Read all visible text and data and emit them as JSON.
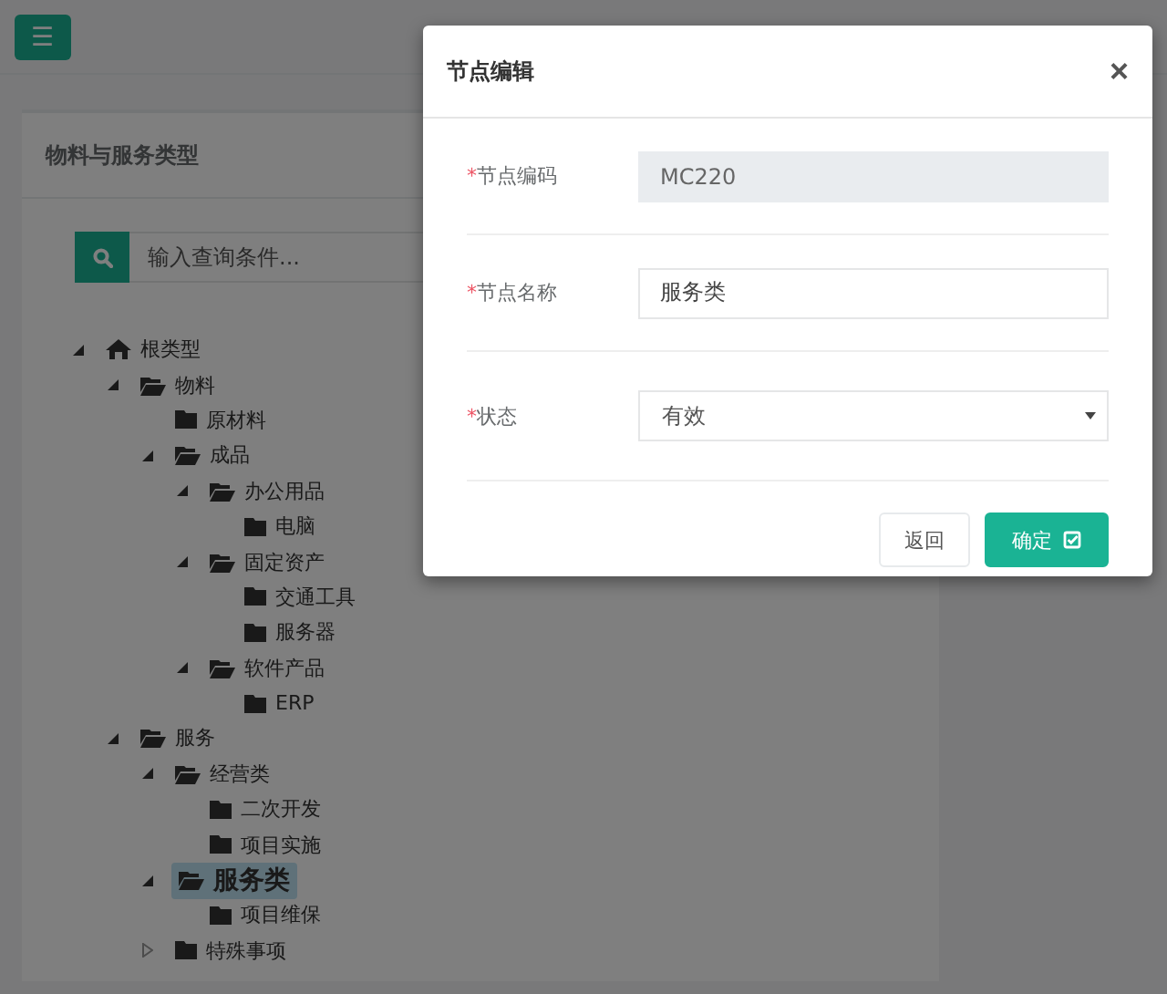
{
  "header": {
    "menu_button": "☰"
  },
  "panel": {
    "title": "物料与服务类型",
    "search": {
      "placeholder": "输入查询条件..."
    },
    "tree": [
      {
        "label": "根类型",
        "kind": "home",
        "expanded": true,
        "selected": false,
        "children": [
          {
            "label": "物料",
            "kind": "folder",
            "expanded": true,
            "selected": false,
            "children": [
              {
                "label": "原材料",
                "kind": "folder",
                "selected": false
              },
              {
                "label": "成品",
                "kind": "folder",
                "expanded": true,
                "selected": false,
                "children": [
                  {
                    "label": "办公用品",
                    "kind": "folder",
                    "expanded": true,
                    "selected": false,
                    "children": [
                      {
                        "label": "电脑",
                        "kind": "folder",
                        "selected": false
                      }
                    ]
                  },
                  {
                    "label": "固定资产",
                    "kind": "folder",
                    "expanded": true,
                    "selected": false,
                    "children": [
                      {
                        "label": "交通工具",
                        "kind": "folder",
                        "selected": false
                      },
                      {
                        "label": "服务器",
                        "kind": "folder",
                        "selected": false
                      }
                    ]
                  },
                  {
                    "label": "软件产品",
                    "kind": "folder",
                    "expanded": true,
                    "selected": false,
                    "children": [
                      {
                        "label": "ERP",
                        "kind": "folder",
                        "selected": false
                      }
                    ]
                  }
                ]
              }
            ]
          },
          {
            "label": "服务",
            "kind": "folder",
            "expanded": true,
            "selected": false,
            "children": [
              {
                "label": "经营类",
                "kind": "folder",
                "expanded": true,
                "selected": false,
                "children": [
                  {
                    "label": "二次开发",
                    "kind": "folder",
                    "selected": false
                  },
                  {
                    "label": "项目实施",
                    "kind": "folder",
                    "selected": false
                  }
                ]
              },
              {
                "label": "服务类",
                "kind": "folder",
                "expanded": true,
                "selected": true,
                "children": [
                  {
                    "label": "项目维保",
                    "kind": "folder",
                    "selected": false
                  }
                ]
              },
              {
                "label": "特殊事项",
                "kind": "folder",
                "expanded": false,
                "selected": false
              }
            ]
          }
        ]
      }
    ]
  },
  "modal": {
    "title": "节点编辑",
    "close": "×",
    "fields": [
      {
        "label": "节点编码",
        "marker": "*",
        "kind": "text",
        "value": "MC220",
        "disabled": true
      },
      {
        "label": "节点名称",
        "marker": "*",
        "kind": "text",
        "value": "服务类",
        "disabled": false
      },
      {
        "label": "状态",
        "marker": "*",
        "kind": "select",
        "value": "有效"
      }
    ],
    "buttons": [
      {
        "label": "返回",
        "kind": "default"
      },
      {
        "label": "确定",
        "kind": "primary"
      }
    ]
  }
}
